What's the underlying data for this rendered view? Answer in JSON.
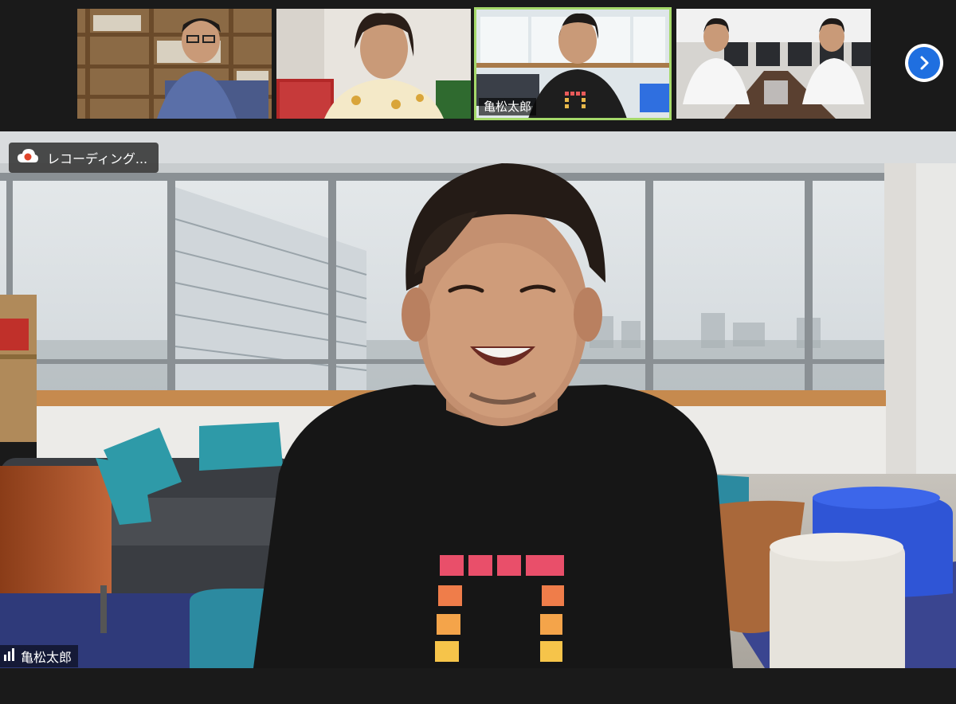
{
  "participants": [
    {
      "name": ""
    },
    {
      "name": ""
    },
    {
      "name": "亀松太郎",
      "active": true
    },
    {
      "name": ""
    }
  ],
  "recording": {
    "label": "レコーディング...",
    "icon": "cloud-record-icon"
  },
  "active_speaker": {
    "name": "亀松太郎",
    "icon": "signal-bars-icon"
  },
  "controls": {
    "next_page_icon": "chevron-right-icon"
  },
  "colors": {
    "active_border": "#a5d96a",
    "next_button": "#1f6fe0",
    "record_dot": "#e0452b"
  }
}
